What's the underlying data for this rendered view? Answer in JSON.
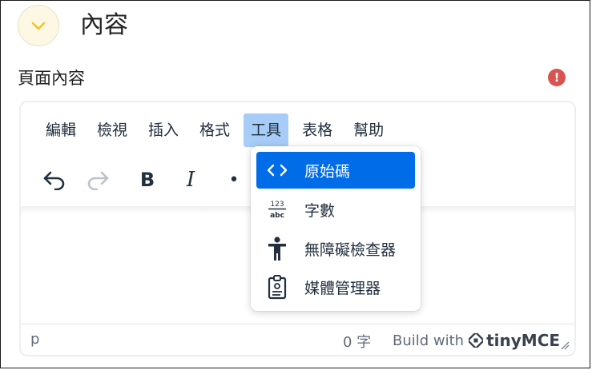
{
  "section": {
    "title": "內容"
  },
  "field": {
    "label": "頁面內容"
  },
  "error": {
    "glyph": "!"
  },
  "menubar": {
    "items": [
      {
        "label": "編輯"
      },
      {
        "label": "檢視"
      },
      {
        "label": "插入"
      },
      {
        "label": "格式"
      },
      {
        "label": "工具",
        "active": true
      },
      {
        "label": "表格"
      },
      {
        "label": "幫助"
      }
    ]
  },
  "toolbar": {
    "bold": "B",
    "italic": "I",
    "more": "•"
  },
  "tools_menu": {
    "items": [
      {
        "label": "原始碼",
        "icon": "source-code-icon",
        "selected": true
      },
      {
        "label": "字數",
        "icon": "word-count-icon"
      },
      {
        "label": "無障礙檢查器",
        "icon": "accessibility-icon"
      },
      {
        "label": "媒體管理器",
        "icon": "media-manager-icon"
      }
    ]
  },
  "statusbar": {
    "path": "p",
    "wordcount": "0 字",
    "branding_text": "Build with",
    "brand_name": "tinyMCE"
  },
  "colors": {
    "accent": "#006ce7",
    "active_menu": "#a6ccf7",
    "error": "#d9534f",
    "collapse_bg": "#fdf8e4",
    "chevron": "#f5c518"
  }
}
